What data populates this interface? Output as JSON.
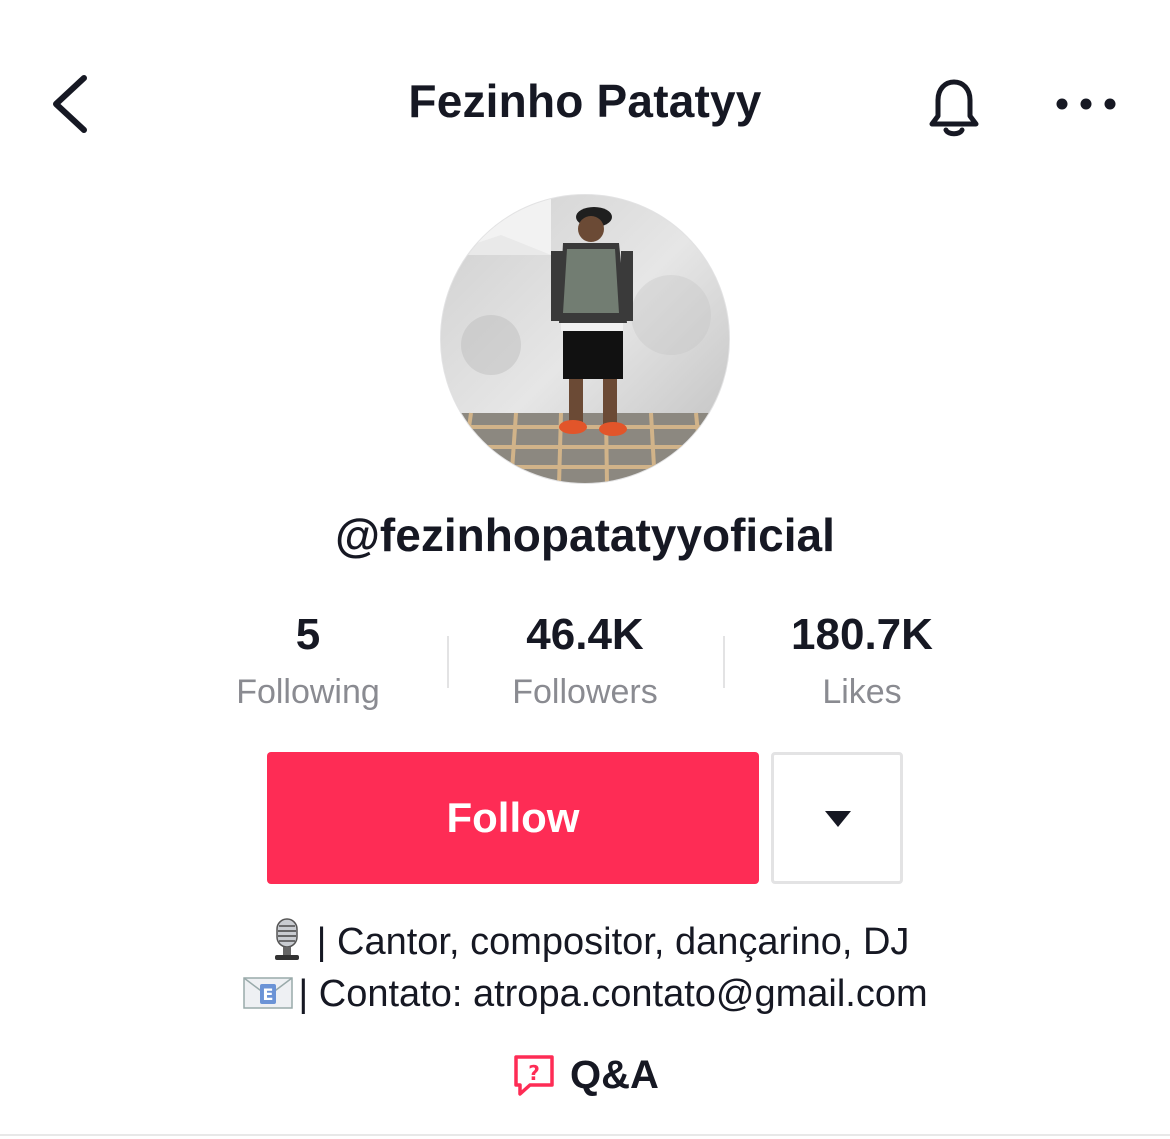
{
  "header": {
    "title": "Fezinho Patatyy",
    "back_icon": "chevron-left-icon",
    "notify_icon": "bell-icon",
    "more_icon": "more-horizontal-icon"
  },
  "profile": {
    "username": "@fezinhopatatyyoficial",
    "avatar": "profile-photo"
  },
  "stats": {
    "following": {
      "value": "5",
      "label": "Following"
    },
    "followers": {
      "value": "46.4K",
      "label": "Followers"
    },
    "likes": {
      "value": "180.7K",
      "label": "Likes"
    }
  },
  "actions": {
    "follow_label": "Follow",
    "dropdown_icon": "caret-down-icon"
  },
  "bio": {
    "line1_emoji": "microphone-emoji",
    "line1_text": "| Cantor, compositor, dançarino, DJ",
    "line2_emoji": "email-emoji",
    "line2_text": "| Contato: atropa.contato@gmail.com"
  },
  "qa": {
    "label": "Q&A",
    "icon": "question-bubble-icon"
  },
  "colors": {
    "accent": "#fe2c55",
    "text": "#161823",
    "secondary_text": "#8a8b91",
    "border": "#e3e3e4"
  }
}
